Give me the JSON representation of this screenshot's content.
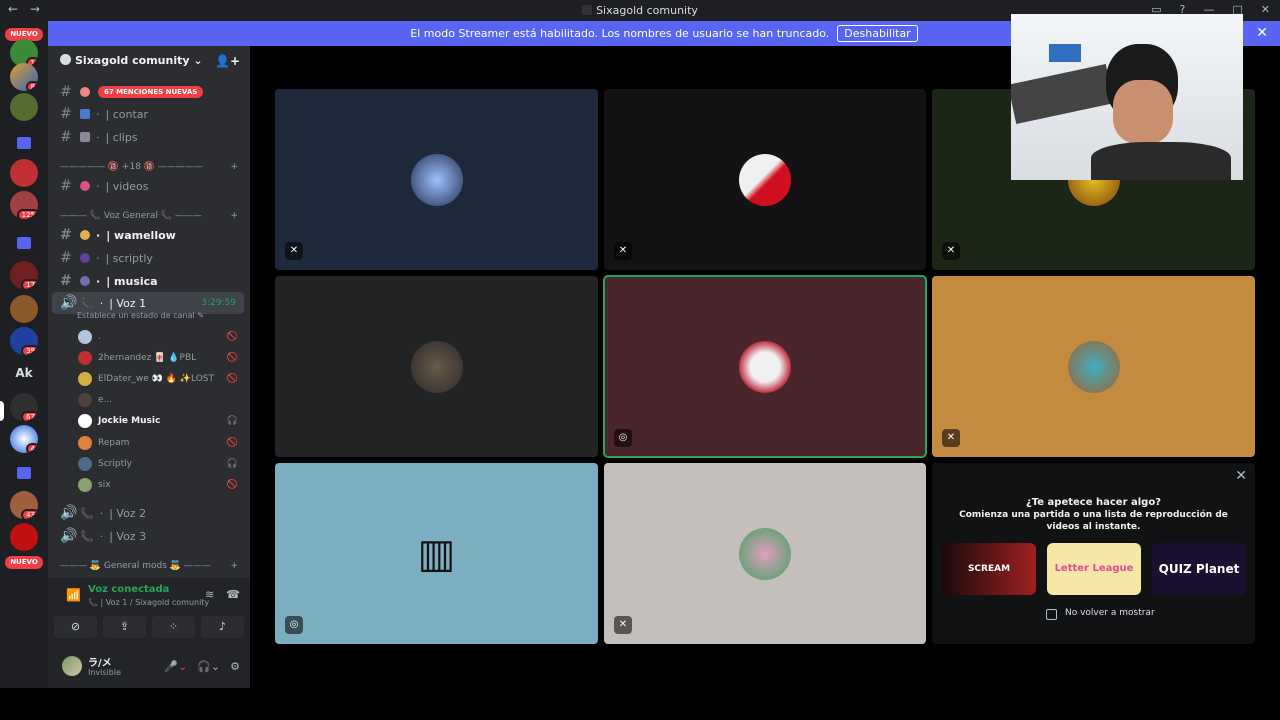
{
  "titlebar": {
    "title": "Sixagold comunity",
    "back": "←",
    "forward": "→"
  },
  "streamer_banner": {
    "text": "El modo Streamer está habilitado. Los nombres de usuario se han truncado.",
    "button": "Deshabilitar",
    "close": "✕"
  },
  "guilds": {
    "nuevo_top": "NUEVO",
    "nuevo_bottom": "NUEVO",
    "badges": [
      "1",
      "8",
      "125",
      "17",
      "39",
      "67",
      "4",
      "43"
    ],
    "ak": "Ak"
  },
  "server": {
    "name": "Sixagold comunity ⌄"
  },
  "mentions_pill": "67 MENCIONES NUEVAS",
  "channels": {
    "contar": "| contar",
    "clips": "| clips",
    "cat_plus18": "————— 🔞 +18 🔞 —————",
    "videos": "| videos",
    "cat_voz": "——— 📞 Voz General 📞 ———",
    "wamellow": "| wamellow",
    "scriptly": "| scriptly",
    "musica": "| musica",
    "voz1": "| Voz 1",
    "voz1_time": "3:29:59",
    "voz1_status": "Establece un estado de canal ✎",
    "voz2": "| Voz 2",
    "voz3": "| Voz 3",
    "cat_mods": "——— 👼 General mods 👼 ———"
  },
  "voice_users": [
    {
      "name": "."
    },
    {
      "name": "2hernandez 🀄 💧PBL"
    },
    {
      "name": "ElDater_we 👀 🔥 ✨LOST"
    },
    {
      "name": "e..."
    },
    {
      "name": "Jockie Music"
    },
    {
      "name": "Repam"
    },
    {
      "name": "Scriptly"
    },
    {
      "name": "six"
    }
  ],
  "voice_connected": {
    "title": "Voz conectada",
    "subtitle": "📞 | Voz 1 / Sixagold comunity"
  },
  "user_panel": {
    "name": "ラ/メ",
    "status": "Invisible"
  },
  "suggestion": {
    "question": "¿Te apetece hacer algo?",
    "description": "Comienza una partida o una lista de reproducción de videos al instante.",
    "activities": [
      "SCREAM",
      "Letter League",
      "QUIZ Planet"
    ],
    "checkbox_label": "No volver a mostrar"
  },
  "colors": {
    "blurple": "#5865f2",
    "green": "#23a55a",
    "red": "#f23f43"
  }
}
